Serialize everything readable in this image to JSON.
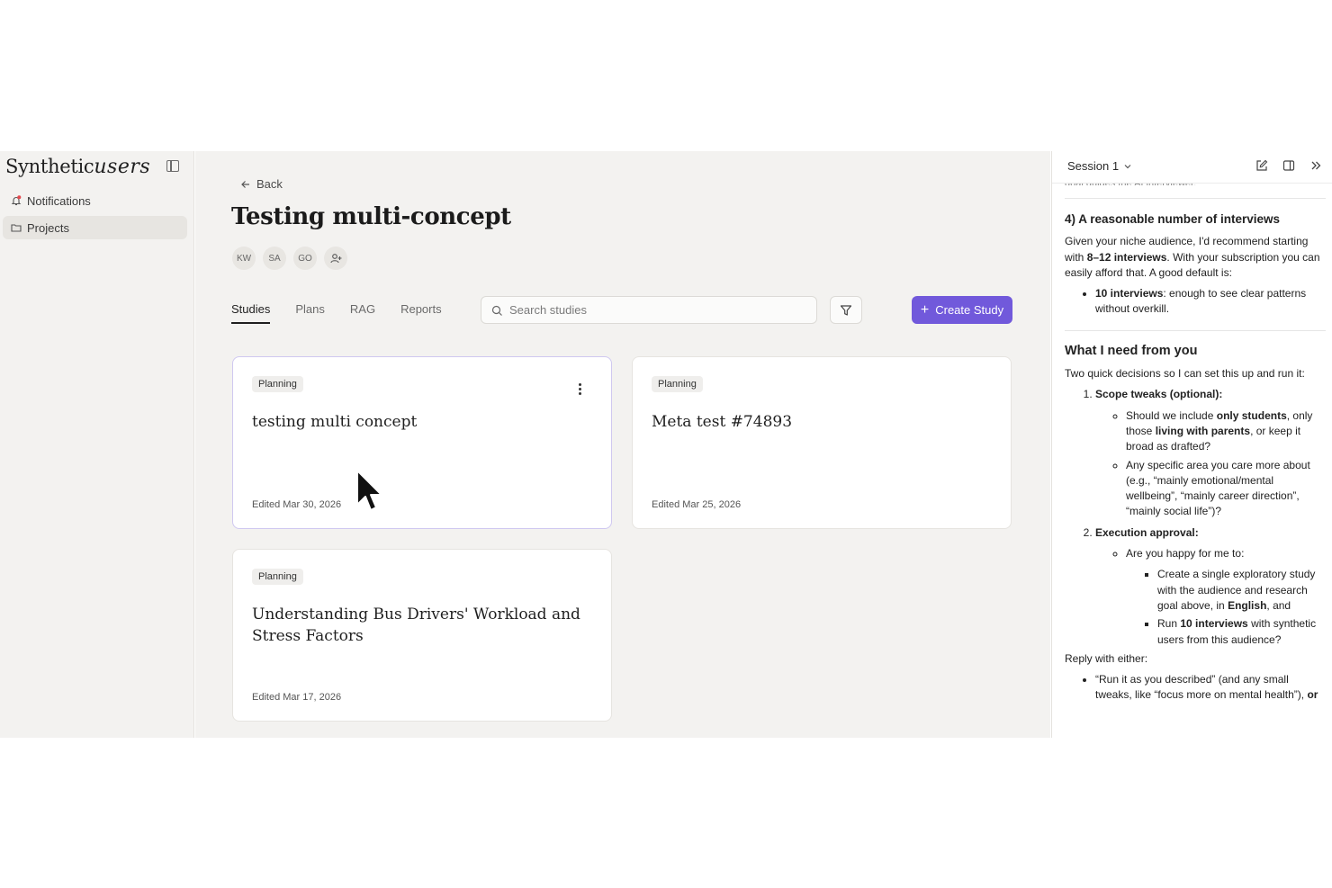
{
  "sidebar": {
    "logo_main": "Synthetic",
    "logo_script": "users",
    "items": [
      {
        "label": "Notifications"
      },
      {
        "label": "Projects"
      }
    ]
  },
  "main": {
    "back_label": "Back",
    "title": "Testing multi-concept",
    "members": [
      "KW",
      "SA",
      "GO"
    ],
    "tabs": [
      {
        "label": "Studies",
        "active": true
      },
      {
        "label": "Plans"
      },
      {
        "label": "RAG"
      },
      {
        "label": "Reports"
      }
    ],
    "search_placeholder": "Search studies",
    "create_label": "Create Study",
    "accent": "#7159db",
    "cards": [
      {
        "status": "Planning",
        "title": "testing multi concept",
        "edited": "Edited Mar 30, 2026"
      },
      {
        "status": "Planning",
        "title": "Meta test #74893",
        "edited": "Edited Mar 25, 2026"
      },
      {
        "status": "Planning",
        "title": "Understanding Bus Drivers' Workload and Stress Factors",
        "edited": "Edited Mar 17, 2026"
      }
    ]
  },
  "panel": {
    "session_label": "Session 1",
    "faded_top": "goal guides the AI interviewer.",
    "section4_heading": "4) A reasonable number of interviews",
    "s4_p1_a": "Given your niche audience, I'd recommend starting with ",
    "s4_p1_b": "8–12 interviews",
    "s4_p1_c": ". With your subscription you can easily afford that. A good default is:",
    "s4_bullet_b": "10 interviews",
    "s4_bullet_c": ": enough to see clear patterns without overkill.",
    "need_heading": "What I need from you",
    "need_intro": "Two quick decisions so I can set this up and run it:",
    "item1_title": "Scope tweaks (optional):",
    "item1_b1_a": "Should we include ",
    "item1_b1_b": "only students",
    "item1_b1_c": ", only those ",
    "item1_b1_d": "living with parents",
    "item1_b1_e": ", or keep it broad as drafted?",
    "item1_b2": "Any specific area you care more about (e.g., “mainly emotional/mental wellbeing”, “mainly career direction”, “mainly social life”)?",
    "item2_title": "Execution approval:",
    "item2_b1": "Are you happy for me to:",
    "item2_s1_a": "Create a single exploratory study with the audience and research goal above, in ",
    "item2_s1_b": "English",
    "item2_s1_c": ", and",
    "item2_s2_a": "Run ",
    "item2_s2_b": "10 interviews",
    "item2_s2_c": " with synthetic users from this audience?",
    "reply_label": "Reply with either:",
    "reply_b1_a": "“Run it as you described” (and any small tweaks, like “focus more on mental health”), ",
    "reply_b1_b": "or"
  }
}
